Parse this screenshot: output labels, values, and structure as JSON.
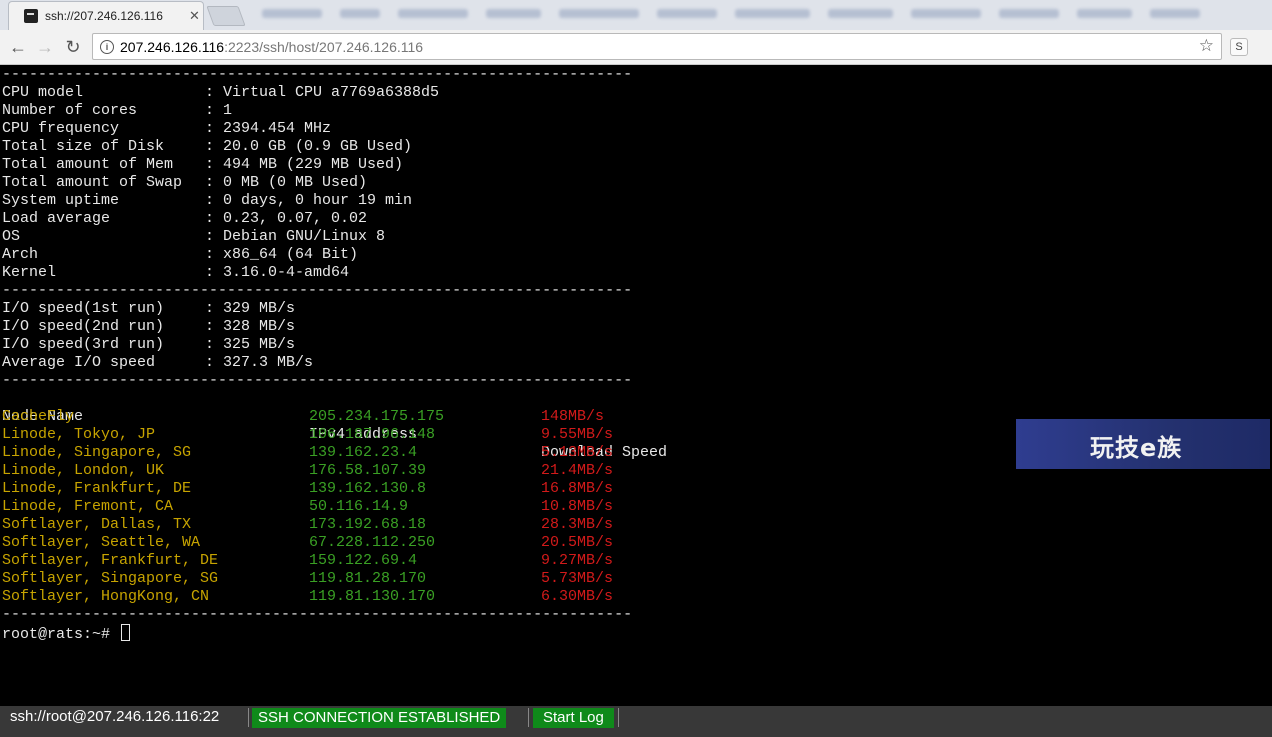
{
  "browser": {
    "tab_title": "ssh://207.246.126.116",
    "url_host": "207.246.126.116",
    "url_rest": ":2223/ssh/host/207.246.126.116",
    "ext_label": "S"
  },
  "terminal": {
    "separator": "----------------------------------------------------------------------",
    "sysinfo": [
      {
        "label": "CPU model",
        "value": "Virtual CPU a7769a6388d5"
      },
      {
        "label": "Number of cores",
        "value": "1"
      },
      {
        "label": "CPU frequency",
        "value": "2394.454 MHz"
      },
      {
        "label": "Total size of Disk",
        "value": "20.0 GB (0.9 GB Used)"
      },
      {
        "label": "Total amount of Mem",
        "value": "494 MB (229 MB Used)"
      },
      {
        "label": "Total amount of Swap",
        "value": "0 MB (0 MB Used)"
      },
      {
        "label": "System uptime",
        "value": "0 days, 0 hour 19 min"
      },
      {
        "label": "Load average",
        "value": "0.23, 0.07, 0.02"
      },
      {
        "label": "OS",
        "value": "Debian GNU/Linux 8"
      },
      {
        "label": "Arch",
        "value": "x86_64 (64 Bit)"
      },
      {
        "label": "Kernel",
        "value": "3.16.0-4-amd64"
      }
    ],
    "io": [
      {
        "label": "I/O speed(1st run)",
        "value": "329 MB/s"
      },
      {
        "label": "I/O speed(2nd run)",
        "value": "328 MB/s"
      },
      {
        "label": "I/O speed(3rd run)",
        "value": "325 MB/s"
      },
      {
        "label": "Average I/O speed",
        "value": "327.3 MB/s"
      }
    ],
    "net_headers": [
      "Node Name",
      "IPv4 address",
      "Download Speed"
    ],
    "net": [
      {
        "node": "CacheFly",
        "ip": "205.234.175.175",
        "speed": "148MB/s"
      },
      {
        "node": "Linode, Tokyo, JP",
        "ip": "106.187.96.148",
        "speed": "9.55MB/s"
      },
      {
        "node": "Linode, Singapore, SG",
        "ip": "139.162.23.4",
        "speed": "5.13MB/s"
      },
      {
        "node": "Linode, London, UK",
        "ip": "176.58.107.39",
        "speed": "21.4MB/s"
      },
      {
        "node": "Linode, Frankfurt, DE",
        "ip": "139.162.130.8",
        "speed": "16.8MB/s"
      },
      {
        "node": "Linode, Fremont, CA",
        "ip": "50.116.14.9",
        "speed": "10.8MB/s"
      },
      {
        "node": "Softlayer, Dallas, TX",
        "ip": "173.192.68.18",
        "speed": "28.3MB/s"
      },
      {
        "node": "Softlayer, Seattle, WA",
        "ip": "67.228.112.250",
        "speed": "20.5MB/s"
      },
      {
        "node": "Softlayer, Frankfurt, DE",
        "ip": "159.122.69.4",
        "speed": "9.27MB/s"
      },
      {
        "node": "Softlayer, Singapore, SG",
        "ip": "119.81.28.170",
        "speed": "5.73MB/s"
      },
      {
        "node": "Softlayer, HongKong, CN",
        "ip": "119.81.130.170",
        "speed": "6.30MB/s"
      }
    ],
    "prompt": "root@rats:~# "
  },
  "watermark": {
    "text": "玩技e族"
  },
  "statusbar": {
    "host": "ssh://root@207.246.126.116:22",
    "status": "SSH CONNECTION ESTABLISHED",
    "start_log": "Start Log"
  },
  "colors": {
    "node": "#c7a400",
    "ip": "#3aa024",
    "speed": "#d21a1a",
    "status_green": "#0f8a1a"
  }
}
